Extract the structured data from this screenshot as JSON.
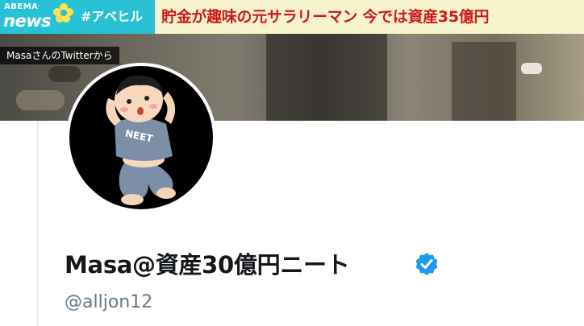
{
  "news_bar": {
    "logo_top": "ABEMA",
    "logo_bottom": "news",
    "hashtag": "#アベヒル",
    "headline": "貯金が趣味の元サラリーマン 今では資産35億円"
  },
  "source_caption": "MasaさんのTwitterから",
  "profile": {
    "avatar_shirt_text": "NEET",
    "display_name": "Masa@資産30億円ニート",
    "handle": "@alljon12",
    "verified_color": "#1d9bf0"
  },
  "colors": {
    "brand_teal": "#26c3d6",
    "headline_bg": "#f7f4cd",
    "headline_text": "#cc1a1a"
  }
}
